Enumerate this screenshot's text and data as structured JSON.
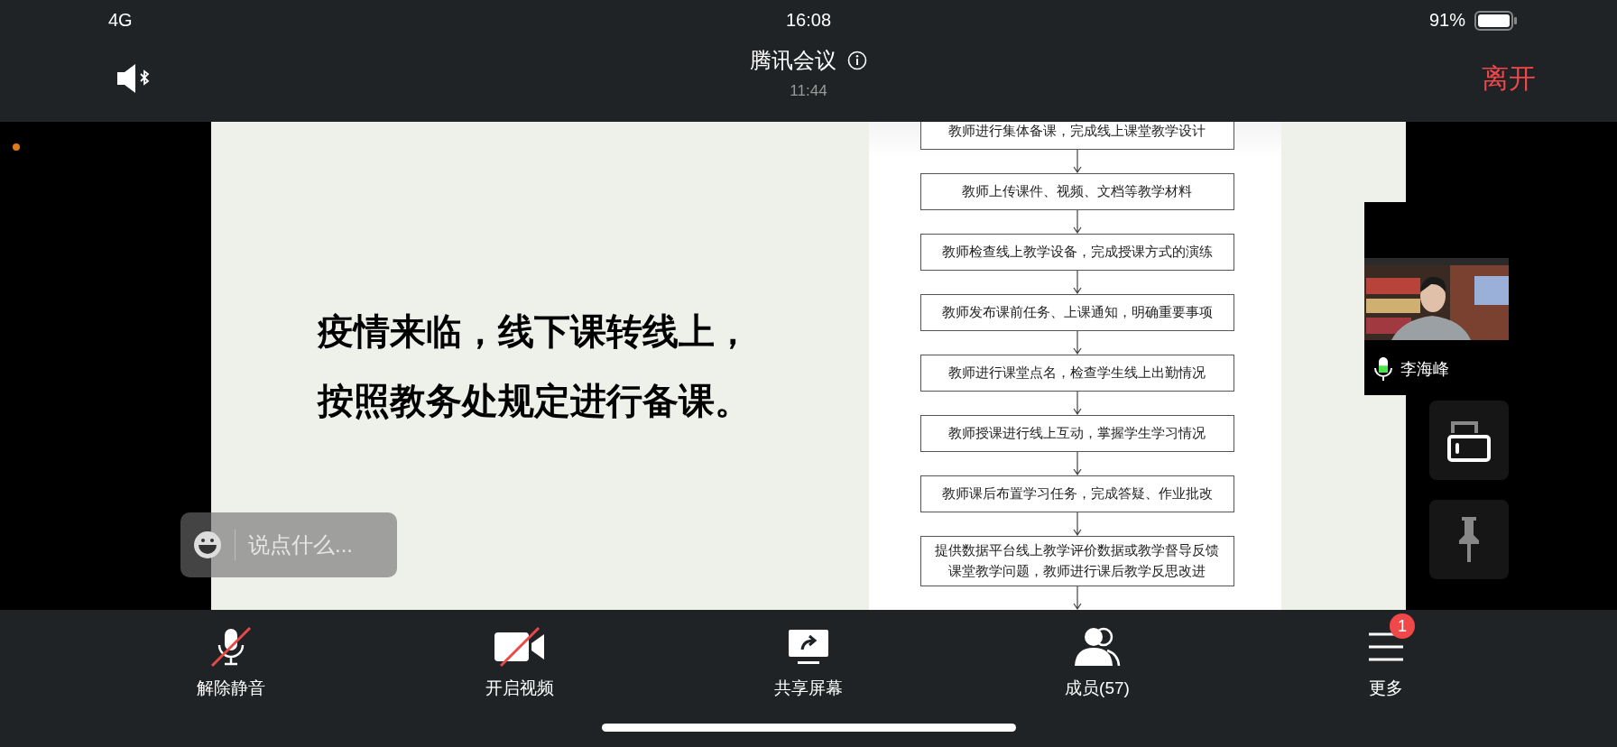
{
  "status_bar": {
    "carrier": "4G",
    "time": "16:08",
    "battery": "91%"
  },
  "header": {
    "title": "腾讯会议",
    "duration": "11:44",
    "leave_button": "离开"
  },
  "slide": {
    "heading_lines": [
      "疫情来临，线下课转线上，",
      "按照教务处规定进行备课。"
    ],
    "flowchart_steps": [
      "教师进行集体备课，完成线上课堂教学设计",
      "教师上传课件、视频、文档等教学材料",
      "教师检查线上教学设备，完成授课方式的演练",
      "教师发布课前任务、上课通知，明确重要事项",
      "教师进行课堂点名，检查学生线上出勤情况",
      "教师授课进行线上互动，掌握学生学习情况",
      "教师课后布置学习任务，完成答疑、作业批改",
      "提供数据平台线上教学评价数据或教学督导反馈课堂教学问题，教师进行课后教学反思改进"
    ]
  },
  "participant": {
    "name": "李海峰",
    "mic": {
      "level": 0.55
    }
  },
  "chat": {
    "placeholder": "说点什么..."
  },
  "toolbar": [
    {
      "kind": "mic",
      "label": "解除静音",
      "crossed_out": true
    },
    {
      "kind": "camera",
      "label": "开启视频",
      "crossed_out": true
    },
    {
      "kind": "share",
      "label": "共享屏幕",
      "crossed_out": false
    },
    {
      "kind": "members",
      "label": "成员(57)",
      "crossed_out": false
    },
    {
      "kind": "more",
      "label": "更多",
      "crossed_out": false,
      "badge": "1"
    }
  ]
}
